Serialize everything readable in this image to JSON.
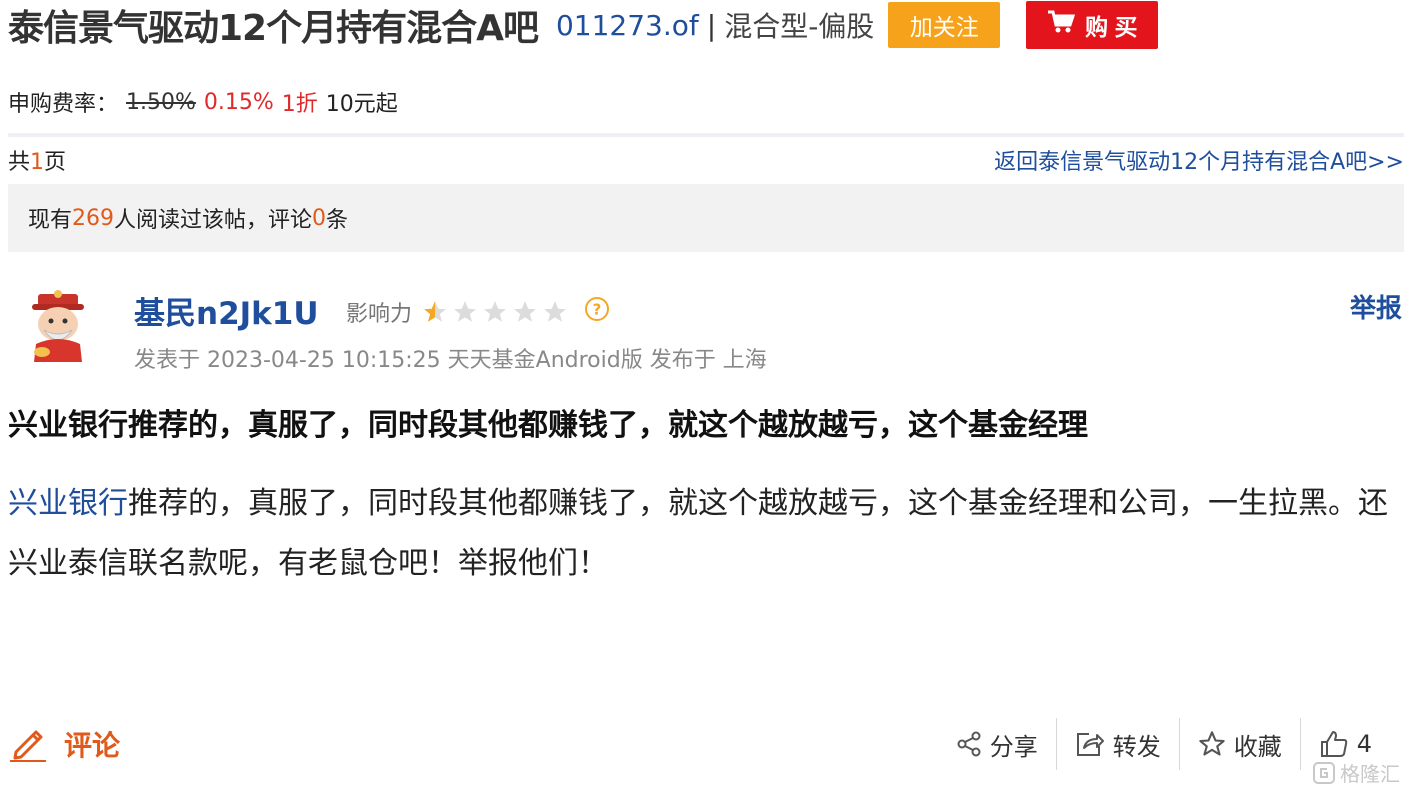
{
  "header": {
    "fund_title": "泰信景气驱动12个月持有混合A吧",
    "fund_code": "011273.of",
    "separator": "|",
    "fund_type": "混合型-偏股",
    "follow_label": "加关注",
    "buy_label": "购 买"
  },
  "fee": {
    "label": "申购费率：",
    "original_rate": "1.50%",
    "discount_rate": "0.15%",
    "discount": "1折",
    "min_amount": "10元起"
  },
  "pager": {
    "prefix": "共",
    "pages": "1",
    "suffix": "页",
    "back_link": "返回泰信景气驱动12个月持有混合A吧>>"
  },
  "stats": {
    "prefix": "现有",
    "readers": "269",
    "middle": "人阅读过该帖，评论",
    "comments": "0",
    "suffix": "条"
  },
  "post": {
    "username": "基民n2Jk1U",
    "influence_label": "影响力",
    "influence_stars": 0.5,
    "report_label": "举报",
    "meta": "发表于 2023-04-25 10:15:25 天天基金Android版 发布于 上海",
    "title": "兴业银行推荐的，真服了，同时段其他都赚钱了，就这个越放越亏，这个基金经理",
    "body_link": "兴业银行",
    "body_text": "推荐的，真服了，同时段其他都赚钱了，就这个越放越亏，这个基金经理和公司，一生拉黑。还兴业泰信联名款呢，有老鼠仓吧！举报他们！"
  },
  "bottom": {
    "comment_label": "评论",
    "share_label": "分享",
    "forward_label": "转发",
    "favorite_label": "收藏",
    "like_count": "4"
  },
  "watermark": "格隆汇",
  "colors": {
    "link_blue": "#1f4e9c",
    "orange": "#e05a1b",
    "follow_orange": "#f7a21b",
    "buy_red": "#e3141b",
    "fee_red": "#e0292b"
  }
}
